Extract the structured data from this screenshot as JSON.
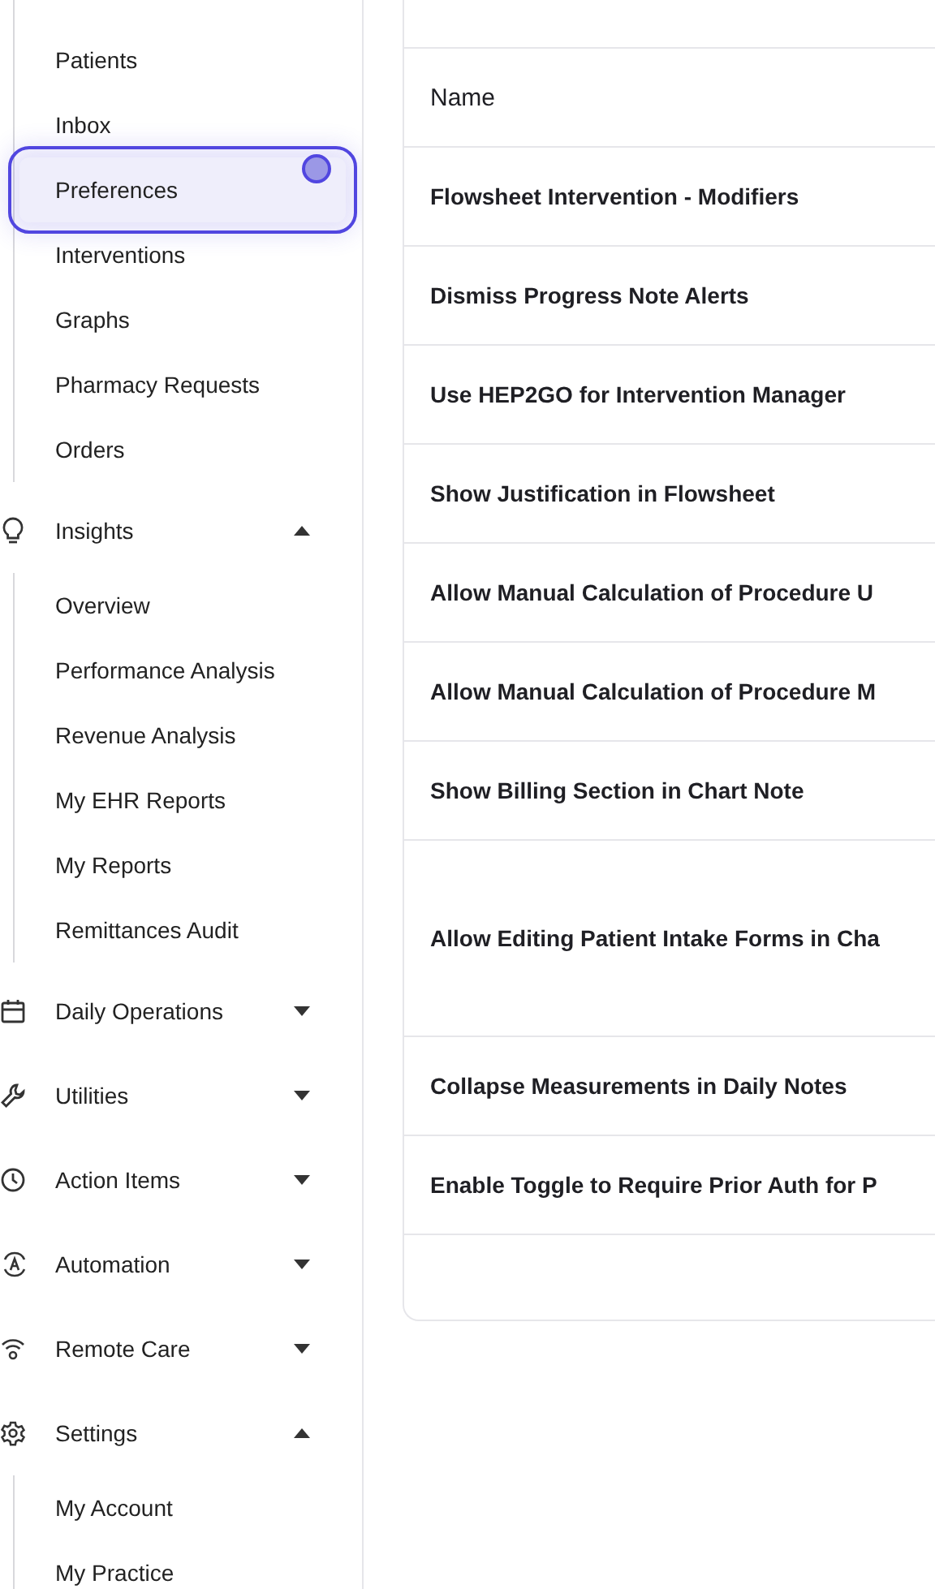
{
  "sidebar": {
    "sections": [
      {
        "items": [
          {
            "label": "Patients",
            "selected": false
          },
          {
            "label": "Inbox",
            "selected": false
          },
          {
            "label": "Preferences",
            "selected": true
          },
          {
            "label": "Interventions",
            "selected": false
          },
          {
            "label": "Graphs",
            "selected": false
          },
          {
            "label": "Pharmacy Requests",
            "selected": false
          },
          {
            "label": "Orders",
            "selected": false
          }
        ]
      },
      {
        "label": "Insights",
        "expanded": true,
        "items": [
          {
            "label": "Overview",
            "selected": false
          },
          {
            "label": "Performance Analysis",
            "selected": false
          },
          {
            "label": "Revenue Analysis",
            "selected": false
          },
          {
            "label": "My EHR Reports",
            "selected": false
          },
          {
            "label": "My Reports",
            "selected": false
          },
          {
            "label": "Remittances Audit",
            "selected": false
          }
        ]
      },
      {
        "label": "Daily Operations",
        "expanded": false
      },
      {
        "label": "Utilities",
        "expanded": false
      },
      {
        "label": "Action Items",
        "expanded": false
      },
      {
        "label": "Automation",
        "expanded": false
      },
      {
        "label": "Remote Care",
        "expanded": false
      },
      {
        "label": "Settings",
        "expanded": true,
        "items": [
          {
            "label": "My Account",
            "selected": false
          },
          {
            "label": "My Practice",
            "selected": false
          }
        ]
      }
    ]
  },
  "preferences_table": {
    "header": "Name",
    "rows": [
      {
        "name": "Flowsheet Intervention - Modifiers",
        "tall": false
      },
      {
        "name": "Dismiss Progress Note Alerts",
        "tall": false
      },
      {
        "name": "Use HEP2GO for Intervention Manager",
        "tall": false
      },
      {
        "name": "Show Justification in Flowsheet",
        "tall": false
      },
      {
        "name": "Allow Manual Calculation of Procedure U",
        "tall": false
      },
      {
        "name": "Allow Manual Calculation of Procedure M",
        "tall": false
      },
      {
        "name": "Show Billing Section in Chart Note",
        "tall": false
      },
      {
        "name": "Allow Editing Patient Intake Forms in Cha",
        "tall": true
      },
      {
        "name": "Collapse Measurements in Daily Notes",
        "tall": false
      },
      {
        "name": "Enable Toggle to Require Prior Auth for P",
        "tall": false
      }
    ]
  }
}
